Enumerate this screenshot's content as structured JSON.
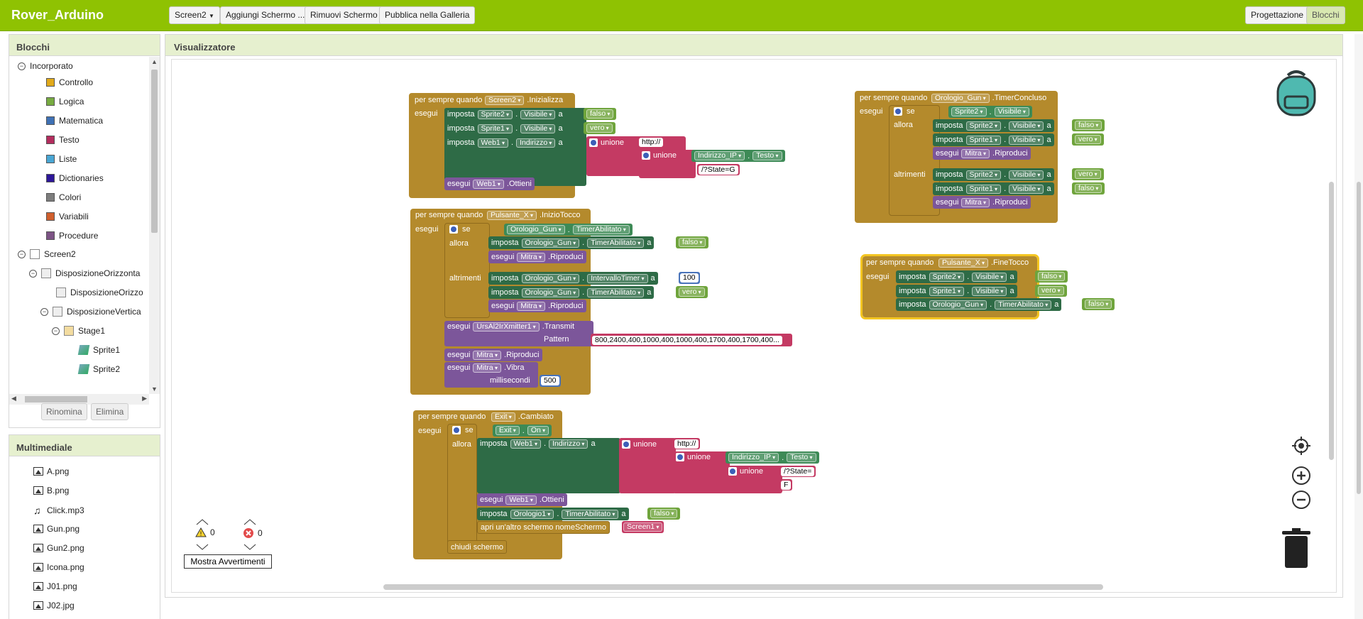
{
  "app": {
    "title": "Rover_Arduino"
  },
  "toolbar": {
    "screen_select": "Screen2",
    "add_screen": "Aggiungi Schermo ...",
    "remove_screen": "Rimuovi Schermo",
    "publish": "Pubblica nella Galleria",
    "designer": "Progettazione",
    "blocks": "Blocchi"
  },
  "blocks_panel": {
    "title": "Blocchi",
    "builtin": "Incorporato",
    "categories": [
      {
        "label": "Controllo",
        "color": "#e1a91a"
      },
      {
        "label": "Logica",
        "color": "#77ab41"
      },
      {
        "label": "Matematica",
        "color": "#3f71b5"
      },
      {
        "label": "Testo",
        "color": "#b32d5e"
      },
      {
        "label": "Liste",
        "color": "#49a6d4"
      },
      {
        "label": "Dictionaries",
        "color": "#2d1799"
      },
      {
        "label": "Colori",
        "color": "#7d7d7d"
      },
      {
        "label": "Variabili",
        "color": "#d05f2d"
      },
      {
        "label": "Procedure",
        "color": "#7c5385"
      }
    ],
    "components": [
      "Screen2",
      "DisposizioneOrizzonta",
      "DisposizioneOrizzo",
      "DisposizioneVertica",
      "Stage1",
      "Sprite1",
      "Sprite2"
    ],
    "rename": "Rinomina",
    "delete": "Elimina"
  },
  "media_panel": {
    "title": "Multimediale",
    "files": [
      "A.png",
      "B.png",
      "Click.mp3",
      "Gun.png",
      "Gun2.png",
      "Icona.png",
      "J01.png",
      "J02.jpg"
    ]
  },
  "viewer": {
    "title": "Visualizzatore",
    "warnings_count": "0",
    "errors_count": "0",
    "show_warnings": "Mostra Avvertimenti"
  },
  "blocks": {
    "w": "per sempre quando",
    "do": "esegui",
    "set": "imposta",
    "to": "a",
    "if": "se",
    "then": "allora",
    "else": "altrimenti",
    "join": "unione",
    "e1": {
      "comp": "Screen2",
      "ev": ".Inizializza",
      "s1c": "Sprite2",
      "s1p": "Visibile",
      "s1v": "falso",
      "s2c": "Sprite1",
      "s2p": "Visibile",
      "s2v": "vero",
      "s3c": "Web1",
      "s3p": "Indirizzo",
      "t1": "http://",
      "t2c": "Indirizzo_IP",
      "t2p": "Testo",
      "t3": "/?State=G",
      "callc": "Web1",
      "callm": ".Ottieni"
    },
    "e2": {
      "comp": "Pulsante_X",
      "ev": ".InizioTocco",
      "cc": "Orologio_Gun",
      "cp": "TimerAbilitato",
      "a1c": "Orologio_Gun",
      "a1p": "TimerAbilitato",
      "a1v": "falso",
      "a2c": "Mitra",
      "a2m": ".Riproduci",
      "b1c": "Orologio_Gun",
      "b1p": "IntervalloTimer",
      "b1v": "100",
      "b2c": "Orologio_Gun",
      "b2p": "TimerAbilitato",
      "b2v": "vero",
      "b3c": "Mitra",
      "b3m": ".Riproduci",
      "irc": "UrsAl2IrXmitter1",
      "irm": ".Transmit",
      "irp": "Pattern",
      "irv": "800,2400,400,1000,400,1000,400,1700,400,1700,400...",
      "pc": "Mitra",
      "pm": ".Riproduci",
      "vc": "Mitra",
      "vm": ".Vibra",
      "vp": "millisecondi",
      "vv": "500"
    },
    "e3": {
      "comp": "Exit",
      "ev": ".Cambiato",
      "cc": "Exit",
      "cp": "On",
      "s1c": "Web1",
      "s1p": "Indirizzo",
      "t1": "http://",
      "t2c": "Indirizzo_IP",
      "t2p": "Testo",
      "t3": "/?State=",
      "t4": "F",
      "callc": "Web1",
      "callm": ".Ottieni",
      "s2c": "Orologio1",
      "s2p": "TimerAbilitato",
      "s2v": "falso",
      "open": "apri un'altro schermo nomeSchermo",
      "openv": "Screen1",
      "close": "chiudi schermo"
    },
    "e4": {
      "comp": "Orologio_Gun",
      "ev": ".TimerConcluso",
      "cc": "Sprite2",
      "cp": "Visibile",
      "a1c": "Sprite2",
      "a1p": "Visibile",
      "a1v": "falso",
      "a2c": "Sprite1",
      "a2p": "Visibile",
      "a2v": "vero",
      "a3c": "Mitra",
      "a3m": ".Riproduci",
      "b1c": "Sprite2",
      "b1p": "Visibile",
      "b1v": "vero",
      "b2c": "Sprite1",
      "b2p": "Visibile",
      "b2v": "falso",
      "b3c": "Mitra",
      "b3m": ".Riproduci"
    },
    "e5": {
      "comp": "Pulsante_X",
      "ev": ".FineTocco",
      "s1c": "Sprite2",
      "s1p": "Visibile",
      "s1v": "falso",
      "s2c": "Sprite1",
      "s2p": "Visibile",
      "s2v": "vero",
      "s3c": "Orologio_Gun",
      "s3p": "TimerAbilitato",
      "s3v": "falso"
    }
  }
}
